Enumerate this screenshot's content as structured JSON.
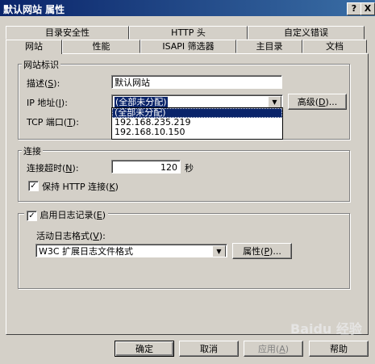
{
  "window": {
    "title": "默认网站 属性",
    "help_btn": "?",
    "close_btn": "X"
  },
  "tabs_back": [
    "目录安全性",
    "HTTP 头",
    "自定义错误"
  ],
  "tabs_front": [
    "网站",
    "性能",
    "ISAPI 筛选器",
    "主目录",
    "文档"
  ],
  "site_id": {
    "group": "网站标识",
    "desc_label": "描述",
    "desc_key": "S",
    "desc_value": "默认网站",
    "ip_label": "IP 地址",
    "ip_key": "I",
    "ip_value": "(全部未分配)",
    "advanced": "高级",
    "advanced_key": "D",
    "tcp_label": "TCP 端口",
    "tcp_key": "T",
    "ip_options": [
      "(全部未分配)",
      "192.168.235.219",
      "192.168.10.150"
    ]
  },
  "connection": {
    "group": "连接",
    "timeout_label": "连接超时",
    "timeout_key": "N",
    "timeout_value": "120",
    "timeout_unit": "秒",
    "keepalive_label": "保持 HTTP 连接",
    "keepalive_key": "K",
    "keepalive_checked": true
  },
  "logging": {
    "enable_label": "启用日志记录",
    "enable_key": "E",
    "enable_checked": true,
    "format_label": "活动日志格式",
    "format_key": "V",
    "format_value": "W3C 扩展日志文件格式",
    "props": "属性",
    "props_key": "P"
  },
  "buttons": {
    "ok": "确定",
    "cancel": "取消",
    "apply": "应用",
    "apply_key": "A",
    "help": "帮助"
  },
  "watermark": "Baidu 经验"
}
